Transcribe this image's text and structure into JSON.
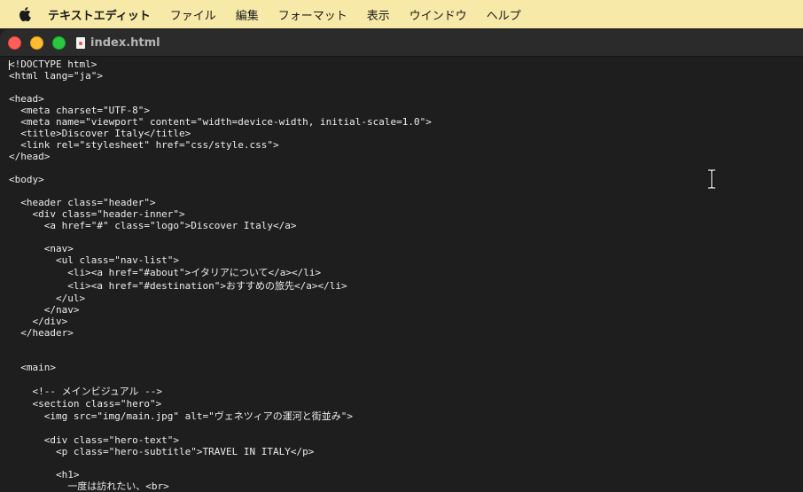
{
  "menubar": {
    "app_name": "テキストエディット",
    "items": [
      "ファイル",
      "編集",
      "フォーマット",
      "表示",
      "ウインドウ",
      "ヘルプ"
    ]
  },
  "window": {
    "title": "index.html"
  },
  "code_lines": [
    "<!DOCTYPE html>",
    "<html lang=\"ja\">",
    "",
    "<head>",
    "  <meta charset=\"UTF-8\">",
    "  <meta name=\"viewport\" content=\"width=device-width, initial-scale=1.0\">",
    "  <title>Discover Italy</title>",
    "  <link rel=\"stylesheet\" href=\"css/style.css\">",
    "</head>",
    "",
    "<body>",
    "",
    "  <header class=\"header\">",
    "    <div class=\"header-inner\">",
    "      <a href=\"#\" class=\"logo\">Discover Italy</a>",
    "",
    "      <nav>",
    "        <ul class=\"nav-list\">",
    "          <li><a href=\"#about\">イタリアについて</a></li>",
    "          <li><a href=\"#destination\">おすすめの旅先</a></li>",
    "        </ul>",
    "      </nav>",
    "    </div>",
    "  </header>",
    "",
    "",
    "  <main>",
    "",
    "    <!-- メインビジュアル -->",
    "    <section class=\"hero\">",
    "      <img src=\"img/main.jpg\" alt=\"ヴェネツィアの運河と街並み\">",
    "",
    "      <div class=\"hero-text\">",
    "        <p class=\"hero-subtitle\">TRAVEL IN ITALY</p>",
    "",
    "        <h1>",
    "          一度は訪れたい、<br>"
  ],
  "colors": {
    "menubar_bg": "#f7e9a7",
    "editor_bg": "#1e1e1e",
    "titlebar_bg": "#2b2b2b",
    "close": "#ff5f57",
    "minimize": "#febc2e",
    "zoom": "#28c840"
  },
  "icons": [
    "apple-logo-icon",
    "html-file-icon",
    "ibeam-cursor-icon"
  ]
}
